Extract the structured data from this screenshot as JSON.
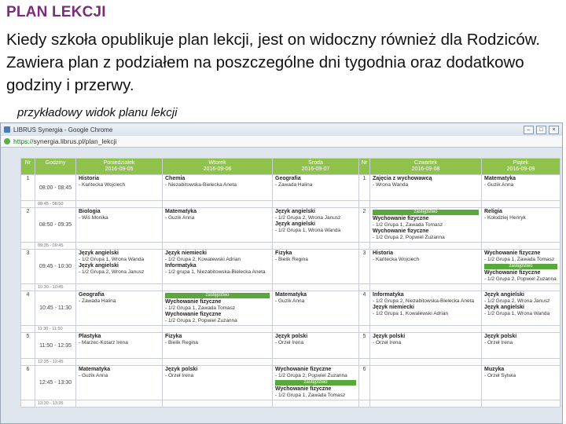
{
  "slide": {
    "title": "PLAN LEKCJI",
    "body": "Kiedy szkoła opublikuje plan lekcji, jest on widoczny również dla Rodziców. Zawiera plan z podziałem na poszczególne dni tygodnia oraz dodatkowo godziny i przerwy.",
    "caption": "przykładowy widok planu lekcji"
  },
  "browser": {
    "title": "LIBRUS Synergia - Google Chrome",
    "url_scheme": "https://",
    "url_rest": "synergia.librus.pl/plan_lekcji"
  },
  "header": {
    "nr": "Nr",
    "godziny": "Godziny",
    "days": [
      {
        "name": "Poniedziałek",
        "date": "2016-09-05"
      },
      {
        "name": "Wtorek",
        "date": "2016-09-06"
      },
      {
        "name": "Środa",
        "date": "2016-09-07"
      },
      {
        "name": "Czwartek",
        "date": "2016-09-08"
      },
      {
        "name": "Piątek",
        "date": "2016-09-09"
      }
    ]
  },
  "breaks": [
    "08:45 - 08:50",
    "09:35 - 09:45",
    "10:30 - 10:45",
    "11:30 - 11:50",
    "12:35 - 12:45",
    "13:30 - 13:35"
  ],
  "badge_label": "zastępstwo",
  "rows": {
    "r1": {
      "nr": "1",
      "time": "08:00 - 08:45",
      "nr_thu": "1",
      "mon": {
        "t": "Historia",
        "s": "- Kańtecka Wojciech"
      },
      "tue": {
        "t": "Chemia",
        "s": "- Niezabitowska-Bielecka Aneta"
      },
      "wed": {
        "t": "Geografia",
        "s": "- Zawada Halina"
      },
      "thu": {
        "t": "Zajęcia z wychowawcą",
        "s": "- Wrona Wanda"
      },
      "fri": {
        "t": "Matematyka",
        "s": "- Guzik Anna"
      }
    },
    "r2": {
      "nr": "2",
      "time": "08:50 - 09:35",
      "nr_thu": "2",
      "mon": {
        "t": "Biologia",
        "s": "- Wiś Monika"
      },
      "tue": {
        "t": "Matematyka",
        "s": "- Guzik Anna"
      },
      "wed": {
        "t": "Język angielski",
        "s": "- 1/2 Grupa 2, Wrona Janusz",
        "t2": "Język angielski",
        "s2": "- 1/2 Grupa 1, Wrona Wanda"
      },
      "thu": {
        "t": "Wychowanie fizyczne",
        "s": "- 1/2 Grupa 1, Zawada Tomasz",
        "t2": "Wychowanie fizyczne",
        "s2": "- 1/2 Grupa 2, Popwiel Zuzanna"
      },
      "fri": {
        "t": "Religia",
        "s": "- Kołodziej Henryk"
      }
    },
    "r3": {
      "nr": "3",
      "time": "09:45 - 10:30",
      "nr_thu": "3",
      "mon": {
        "t": "Język angielski",
        "s": "- 1/2 Grupa 1, Wrona Wanda",
        "t2": "Język angielski",
        "s2": "- 1/2 Grupa 2, Wrona Janusz"
      },
      "tue": {
        "t": "Język niemiecki",
        "s": "- 1/2 Grupa 2, Kowalewski Adrian",
        "t2": "Informatyka",
        "s2": "- 1/2 grupa 1, Niezabitowska-Bielecka Aneta"
      },
      "wed": {
        "t": "Fizyka",
        "s": "- Bielik Regina"
      },
      "thu": {
        "t": "Historia",
        "s": "- Kańtecka Wojciech"
      },
      "fri": {
        "t": "Wychowanie fizyczne",
        "s": "- 1/2 Grupa 1, Zawada Tomasz",
        "t2": "Wychowanie fizyczne",
        "s2": "- 1/2 Grupa 2, Popwiel Zuzanna"
      }
    },
    "r4": {
      "nr": "4",
      "time": "10:45 - 11:30",
      "nr_thu": "4",
      "mon": {
        "t": "Geografia",
        "s": "- Zawada Halina"
      },
      "tue": {
        "t": "Wychowanie fizyczne",
        "s": "- 1/2 Grupa 1, Zawada Tomasz",
        "t2": "Wychowanie fizyczne",
        "s2": "- 1/2 Grupa 2, Popwiel Zuzanna"
      },
      "wed": {
        "t": "Matematyka",
        "s": "- Guzik Anna"
      },
      "thu": {
        "t": "Informatyka",
        "s": "- 1/2 Grupa 2, Niezabitowska-Bielecka Aneta",
        "t2": "Język niemiecki",
        "s2": "- 1/2 Grupa 1, Kowalewski Adrian"
      },
      "fri": {
        "t": "Język angielski",
        "s": "- 1/2 Grupa 2, Wrona Janusz",
        "t2": "Język angielski",
        "s2": "- 1/2 Grupa 1, Wrona Wanda"
      }
    },
    "r5": {
      "nr": "5",
      "time": "11:50 - 12:35",
      "nr_thu": "5",
      "mon": {
        "t": "Plastyka",
        "s": "- Marzec-Kotarz Irena"
      },
      "tue": {
        "t": "Fizyka",
        "s": "- Bielik Regina"
      },
      "wed": {
        "t": "Język polski",
        "s": "- Orzeł Irena"
      },
      "thu": {
        "t": "Język polski",
        "s": "- Orzeł Irena"
      },
      "fri": {
        "t": "Język polski",
        "s": "- Orzeł Irena"
      }
    },
    "r6": {
      "nr": "6",
      "time": "12:45 - 13:30",
      "nr_thu": "6",
      "mon": {
        "t": "Matematyka",
        "s": "- Guzik Anna"
      },
      "tue": {
        "t": "Język polski",
        "s": "- Orzeł Irena"
      },
      "wed": {
        "t": "Wychowanie fizyczne",
        "s": "- 1/2 Grupa 2, Popwiel Zuzanna",
        "t2": "Wychowanie fizyczne",
        "s2": "- 1/2 Grupa 1, Zawada Tomasz"
      },
      "thu": {
        "t": "",
        "s": ""
      },
      "fri": {
        "t": "Muzyka",
        "s": "- Orzeł Sylwia"
      }
    }
  }
}
